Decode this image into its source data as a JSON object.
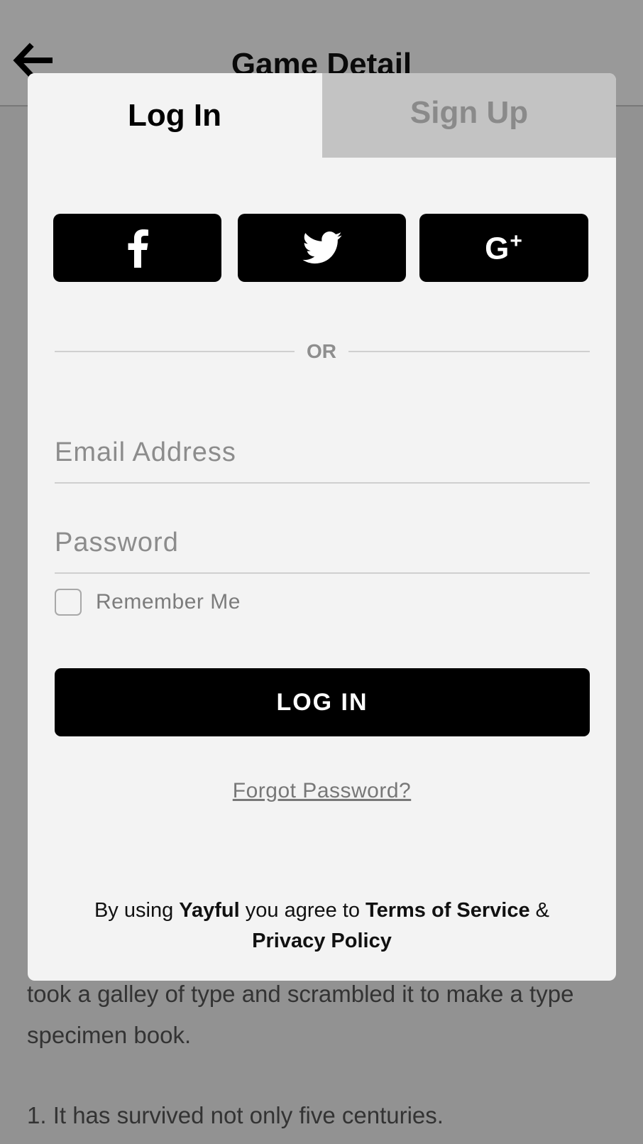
{
  "nav": {
    "title": "Game Detail",
    "back_icon": "arrow-left-icon"
  },
  "background": {
    "paragraph1": "took a galley of type and scrambled it to make a type specimen book.",
    "paragraph2": "1. It has survived not only five centuries."
  },
  "tabs": {
    "login_label": "Log In",
    "signup_label": "Sign Up",
    "active": "login"
  },
  "social": {
    "facebook_icon": "facebook-icon",
    "twitter_icon": "twitter-icon",
    "google_plus_icon": "google-plus-icon",
    "google_plus_text": "G",
    "google_plus_sup": "+"
  },
  "divider": {
    "or_label": "OR"
  },
  "form": {
    "email_placeholder": "Email Address",
    "email_value": "",
    "password_placeholder": "Password",
    "password_value": "",
    "remember_label": "Remember Me",
    "remember_checked": false,
    "submit_label": "LOG IN",
    "forgot_label": "Forgot Password?"
  },
  "terms": {
    "prefix": "By using ",
    "brand": "Yayful",
    "middle": " you agree to ",
    "tos": "Terms of Service",
    "amp": " &",
    "privacy": "Privacy Policy"
  },
  "colors": {
    "button": "#000000",
    "modal_bg": "#f3f3f3",
    "inactive_tab": "#c3c3c3",
    "overlay": "rgba(0,0,0,0.40)"
  }
}
